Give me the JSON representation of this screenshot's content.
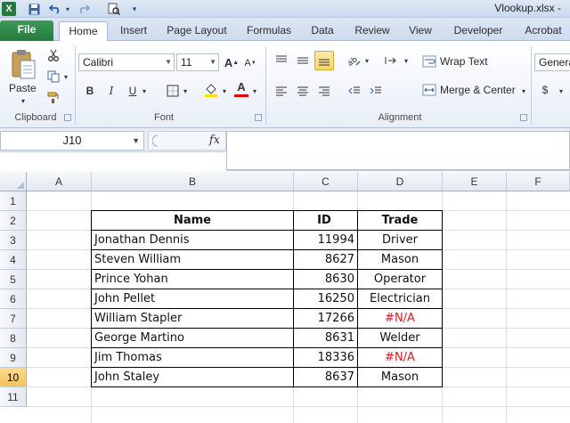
{
  "window": {
    "title": "Vlookup.xlsx -"
  },
  "qat": {
    "excel_logo": "X",
    "save_icon": "save-icon",
    "undo_icon": "undo-icon",
    "redo_icon": "redo-icon",
    "print_icon": "print-preview-icon"
  },
  "tabs": [
    "File",
    "Home",
    "Insert",
    "Page Layout",
    "Formulas",
    "Data",
    "Review",
    "View",
    "Developer",
    "Acrobat"
  ],
  "ribbon": {
    "clipboard": {
      "paste_label": "Paste",
      "group_label": "Clipboard"
    },
    "font": {
      "name": "Calibri",
      "size": "11",
      "bold": "B",
      "italic": "I",
      "underline": "U",
      "group_label": "Font",
      "font_color": "#e00000",
      "fill_color": "#ffe000"
    },
    "alignment": {
      "wrap_text": "Wrap Text",
      "merge_center": "Merge & Center",
      "group_label": "Alignment"
    },
    "number": {
      "format": "Genera",
      "currency": "$"
    }
  },
  "formula_bar": {
    "name_box": "J10",
    "fx_label": "fx",
    "value": ""
  },
  "columns": [
    "A",
    "B",
    "C",
    "D",
    "E",
    "F"
  ],
  "rows": [
    "1",
    "2",
    "3",
    "4",
    "5",
    "6",
    "7",
    "8",
    "9",
    "10",
    "11"
  ],
  "selected_row": "10",
  "table": {
    "headers": {
      "name": "Name",
      "id": "ID",
      "trade": "Trade"
    },
    "rows": [
      {
        "name": "Jonathan Dennis",
        "id": "11994",
        "trade": "Driver"
      },
      {
        "name": "Steven William",
        "id": "8627",
        "trade": "Mason"
      },
      {
        "name": "Prince Yohan",
        "id": "8630",
        "trade": "Operator"
      },
      {
        "name": "John Pellet",
        "id": "16250",
        "trade": "Electrician"
      },
      {
        "name": "William Stapler",
        "id": "17266",
        "trade": "#N/A"
      },
      {
        "name": "George Martino",
        "id": "8631",
        "trade": "Welder"
      },
      {
        "name": "Jim Thomas",
        "id": "18336",
        "trade": "#N/A"
      },
      {
        "name": "John Staley",
        "id": "8637",
        "trade": "Mason"
      }
    ]
  },
  "colors": {
    "file_tab": "#217a3b",
    "error_text": "#d0201a",
    "selected_row_header": "#f4c45f"
  }
}
